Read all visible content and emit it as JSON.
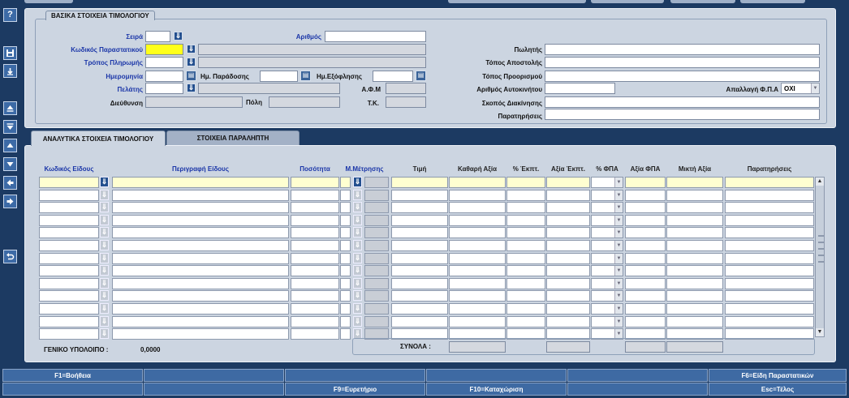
{
  "header": {
    "group_title": "ΒΑΣΙΚΑ ΣΤΟΙΧΕΙΑ ΤΙΜΟΛΟΓΙΟΥ",
    "labels": {
      "series": "Σειρά",
      "number": "Αριθμός",
      "doc_code": "Κωδικός Παραστατικού",
      "payment": "Τρόπος Πληρωμής",
      "date": "Ημερομηνία",
      "delivery_date": "Ημ. Παράδοσης",
      "payment_date": "Ημ.Εξόφλησης",
      "customer": "Πελάτης",
      "afm": "Α.Φ.Μ",
      "address": "Διεύθυνση",
      "city": "Πόλη",
      "tk": "Τ.Κ.",
      "seller": "Πωλητής",
      "dispatch_place": "Τόπος Αποστολής",
      "destination": "Τόπος Προορισμού",
      "vehicle": "Αριθμός Αυτοκινήτου",
      "vat_exempt": "Απαλλαγή Φ.Π.Α",
      "purpose": "Σκοπός Διακίνησης",
      "remarks": "Παρατηρήσεις"
    },
    "vat_exempt_value": "ΟΧΙ"
  },
  "tabs": [
    {
      "label": "ΑΝΑΛΥΤΙΚΑ ΣΤΟΙΧΕΙΑ ΤΙΜΟΛΟΓΙΟΥ"
    },
    {
      "label": "ΣΤΟΙΧΕΙΑ ΠΑΡΑΛΗΠΤΗ"
    }
  ],
  "table": {
    "columns": {
      "item_code": "Κωδικός Είδους",
      "description": "Περιγραφή Είδους",
      "quantity": "Ποσότητα",
      "unit": "Μ.Μέτρησης",
      "price": "Τιμή",
      "net_value": "Καθαρή Αξία",
      "disc_pct": "% Έκπτ.",
      "disc_value": "Αξία Έκπτ.",
      "vat_pct": "% ΦΠΑ",
      "vat_value": "Αξία ΦΠΑ",
      "gross_value": "Μικτή Αξία",
      "remarks": "Παρατηρήσεις"
    }
  },
  "summary": {
    "balance_label": "ΓΕΝΙΚΟ ΥΠΟΛΟΙΠΟ :",
    "balance_value": "0,0000",
    "totals_label": "ΣΥΝΟΛΑ :"
  },
  "fkeys": {
    "f1": "F1=Βοήθεια",
    "f6": "F6=Είδη Παραστατικών",
    "f9": "F9=Ευρετήριο",
    "f10": "F10=Καταχώριση",
    "esc": "Esc=Τέλος"
  },
  "sidebar": {
    "help_glyph": "?"
  },
  "colors": {
    "background": "#1c3a62",
    "panel": "#ccd5e1",
    "required_field": "#ffff1a",
    "active_row": "#ffffd1",
    "label_blue": "#1b36a8",
    "button": "#3e6aa3"
  }
}
